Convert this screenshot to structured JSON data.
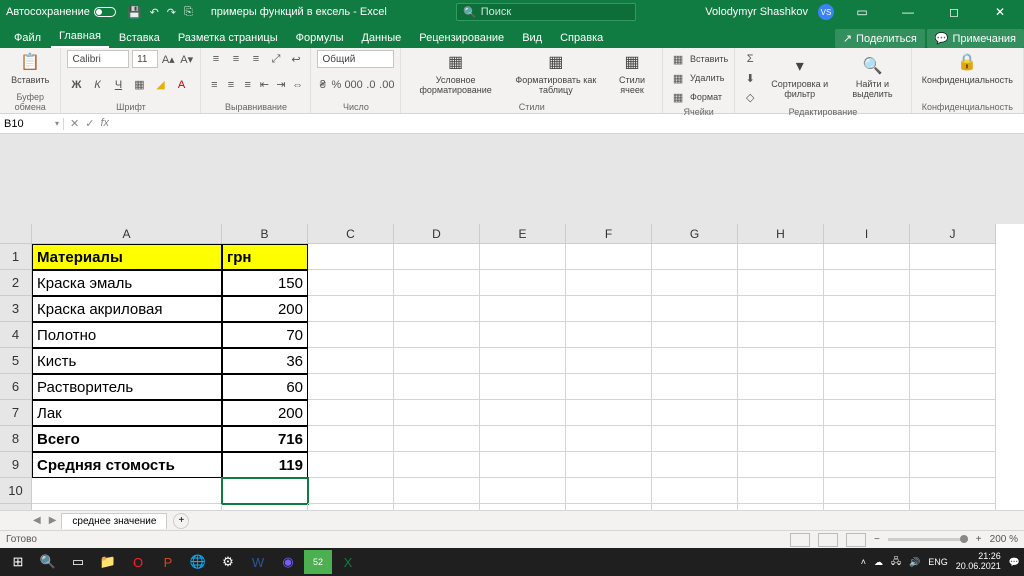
{
  "titlebar": {
    "autosave": "Автосохранение",
    "docname": "примеры функций в ексель - Excel",
    "search_placeholder": "Поиск",
    "user": "Volodymyr Shashkov",
    "avatar": "VS"
  },
  "tabs": {
    "items": [
      "Файл",
      "Главная",
      "Вставка",
      "Разметка страницы",
      "Формулы",
      "Данные",
      "Рецензирование",
      "Вид",
      "Справка"
    ],
    "active": 1,
    "share": "Поделиться",
    "comments": "Примечания"
  },
  "ribbon": {
    "clipboard": {
      "paste": "Вставить",
      "label": "Буфер обмена"
    },
    "font": {
      "name": "Calibri",
      "size": "11",
      "label": "Шрифт"
    },
    "alignment": {
      "label": "Выравнивание"
    },
    "number": {
      "format": "Общий",
      "label": "Число"
    },
    "styles": {
      "cond": "Условное форматирование",
      "table": "Форматировать как таблицу",
      "cell": "Стили ячеек",
      "label": "Стили"
    },
    "cells": {
      "insert": "Вставить",
      "delete": "Удалить",
      "format": "Формат",
      "label": "Ячейки"
    },
    "editing": {
      "sort": "Сортировка и фильтр",
      "find": "Найти и выделить",
      "label": "Редактирование"
    },
    "confidential": {
      "btn": "Конфиденциальность",
      "label": "Конфиденциальность"
    }
  },
  "namebox": "B10",
  "chart_data": {
    "type": "table",
    "columns": [
      "Материалы",
      "грн"
    ],
    "rows": [
      {
        "material": "Краска эмаль",
        "price": 150
      },
      {
        "material": "Краска акриловая",
        "price": 200
      },
      {
        "material": "Полотно",
        "price": 70
      },
      {
        "material": "Кисть",
        "price": 36
      },
      {
        "material": "Растворитель",
        "price": 60
      },
      {
        "material": "Лак",
        "price": 200
      }
    ],
    "totals": [
      {
        "label": "Всего",
        "value": 716
      },
      {
        "label": "Средняя стомость",
        "value": 119
      }
    ]
  },
  "columns": [
    "A",
    "B",
    "C",
    "D",
    "E",
    "F",
    "G",
    "H",
    "I",
    "J"
  ],
  "sheet": {
    "name": "среднее значение"
  },
  "status": {
    "ready": "Готово",
    "zoom": "200 %"
  },
  "taskbar": {
    "lang": "ENG",
    "time": "21:26",
    "date": "20.06.2021"
  }
}
